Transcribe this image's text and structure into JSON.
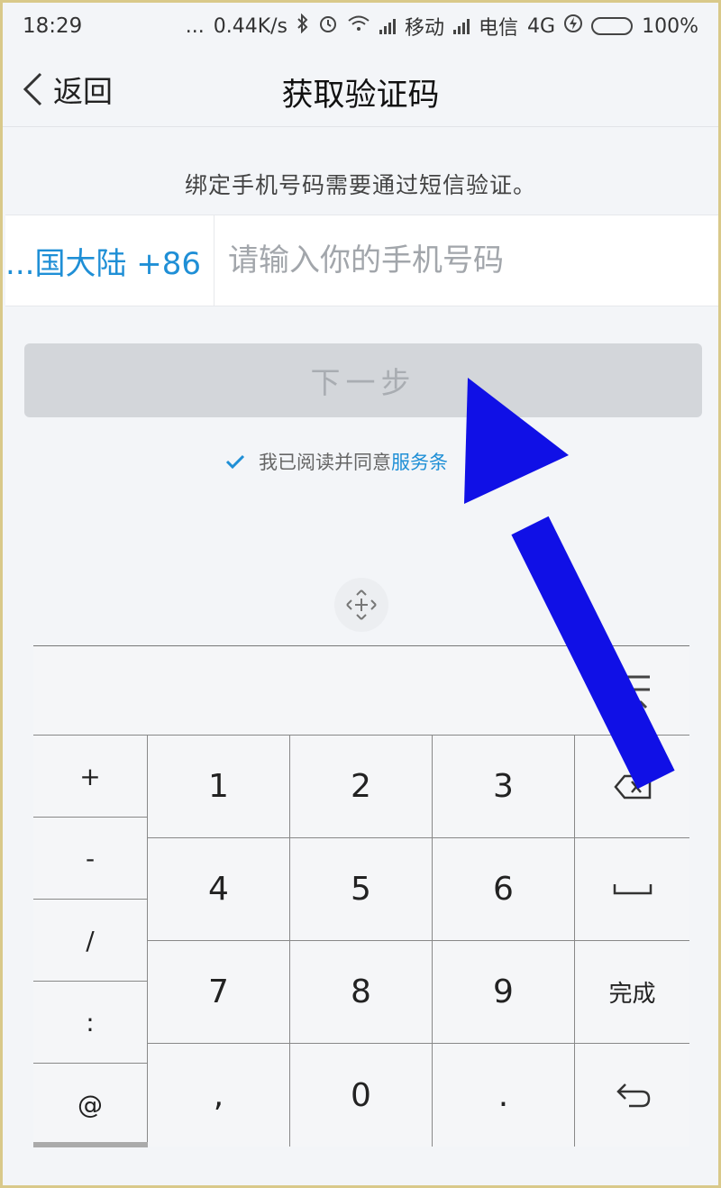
{
  "status": {
    "time": "18:29",
    "dots": "...",
    "speed": "0.44K/s",
    "carrier1": "移动",
    "carrier2": "电信",
    "network": "4G",
    "battery": "100%"
  },
  "nav": {
    "back_label": "返回",
    "title": "获取验证码"
  },
  "form": {
    "hint": "绑定手机号码需要通过短信验证。",
    "region": "...国大陆 +86",
    "phone_placeholder": "请输入你的手机号码",
    "next_label": "下一步",
    "agree_text": "我已阅读并同意",
    "agree_link": "服务条"
  },
  "keyboard": {
    "symbols": [
      "+",
      "-",
      "/",
      ":",
      "@"
    ],
    "rows": [
      [
        "1",
        "2",
        "3",
        "⌫"
      ],
      [
        "4",
        "5",
        "6",
        "␣"
      ],
      [
        "7",
        "8",
        "9",
        "完成"
      ],
      [
        ",",
        "0",
        ".",
        "↩"
      ]
    ]
  },
  "colors": {
    "accent": "#1f8fd6",
    "arrow": "#1010e6"
  }
}
